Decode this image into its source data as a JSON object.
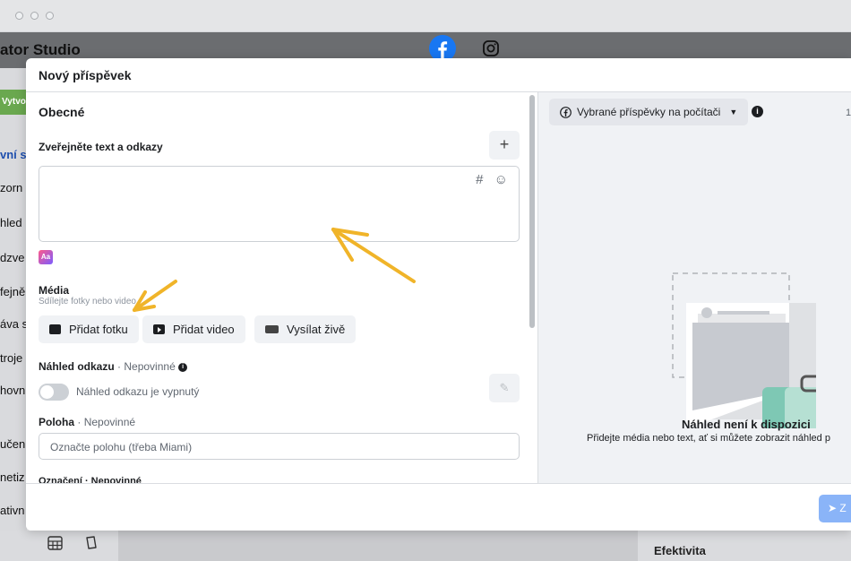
{
  "window": {
    "app_title": "ator Studio"
  },
  "header": {
    "facebook_icon": "facebook-icon",
    "instagram_icon": "instagram-icon"
  },
  "background_sidebar": {
    "create_label": "Vytvo",
    "items": [
      "vní st",
      "zorn",
      "hled",
      "dzve",
      "fejně",
      "áva s",
      "troje",
      "hovn",
      "učen",
      "netiz",
      "ativn"
    ]
  },
  "background": {
    "efektivita": "Efektivita"
  },
  "modal": {
    "title": "Nový příspěvek",
    "general_heading": "Obecné",
    "publish_label": "Zveřejněte text a odkazy",
    "add_button": "+",
    "textarea_icons": "# ☺",
    "media_label": "Média",
    "media_sublabel": "Sdílejte fotky nebo video",
    "add_photo": "Přidat fotku",
    "add_video": "Přidat video",
    "go_live": "Vysílat živě",
    "link_preview_label": "Náhled odkazu",
    "link_preview_opt": "· Nepovinné",
    "link_preview_toggle": "Náhled odkazu je vypnutý",
    "location_label": "Poloha",
    "location_opt": "· Nepovinné",
    "location_placeholder": "Označte polohu (třeba Miami)",
    "tag_label": "Označení · Nepovinné"
  },
  "preview": {
    "select_label": "Vybrané příspěvky na počítači",
    "right_number": "1",
    "title": "Náhled není k dispozici",
    "subtitle": "Přidejte média nebo text, ať si můžete zobrazit náhled p"
  },
  "footer": {
    "send_label": "Z"
  },
  "colors": {
    "accent_arrow": "#f0b429",
    "primary_button": "#8ab4f8",
    "toggle_off": "#ccd0d5"
  }
}
